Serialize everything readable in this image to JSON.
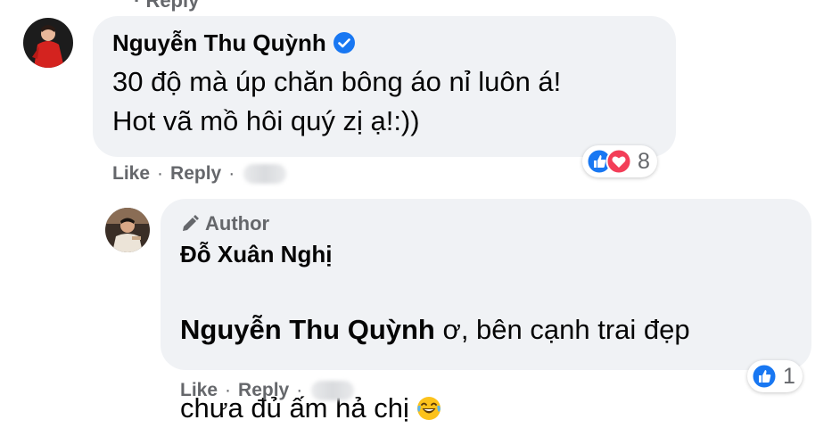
{
  "comment1": {
    "author": "Nguyễn Thu Quỳnh",
    "verified_icon": "verified-badge-icon",
    "text": "30 độ mà úp chăn bông áo nỉ luôn á!\nHot vã mồ hôi quý zị ạ!:))",
    "actions": {
      "like": "Like",
      "reply": "Reply",
      "separator": "·"
    },
    "reactions": {
      "icons": [
        "like-icon",
        "love-icon"
      ],
      "count": "8"
    }
  },
  "comment2": {
    "badge": "Author",
    "badge_icon": "pencil-icon",
    "author": "Đỗ Xuân Nghị",
    "mention": "Nguyễn Thu Quỳnh",
    "text_line1": " ơ, bên cạnh trai đẹp",
    "text_line2": "chưa đủ ấm hả chị ",
    "emoji": "laughing-tears-emoji",
    "actions": {
      "like": "Like",
      "reply": "Reply",
      "separator": "·"
    },
    "reactions": {
      "icons": [
        "like-icon"
      ],
      "count": "1"
    }
  },
  "colors": {
    "bubble": "#f0f2f5",
    "secondary_text": "#65676b",
    "like_blue": "#1877f2",
    "love_red": "#f33e58",
    "verified_blue": "#1877f2"
  }
}
